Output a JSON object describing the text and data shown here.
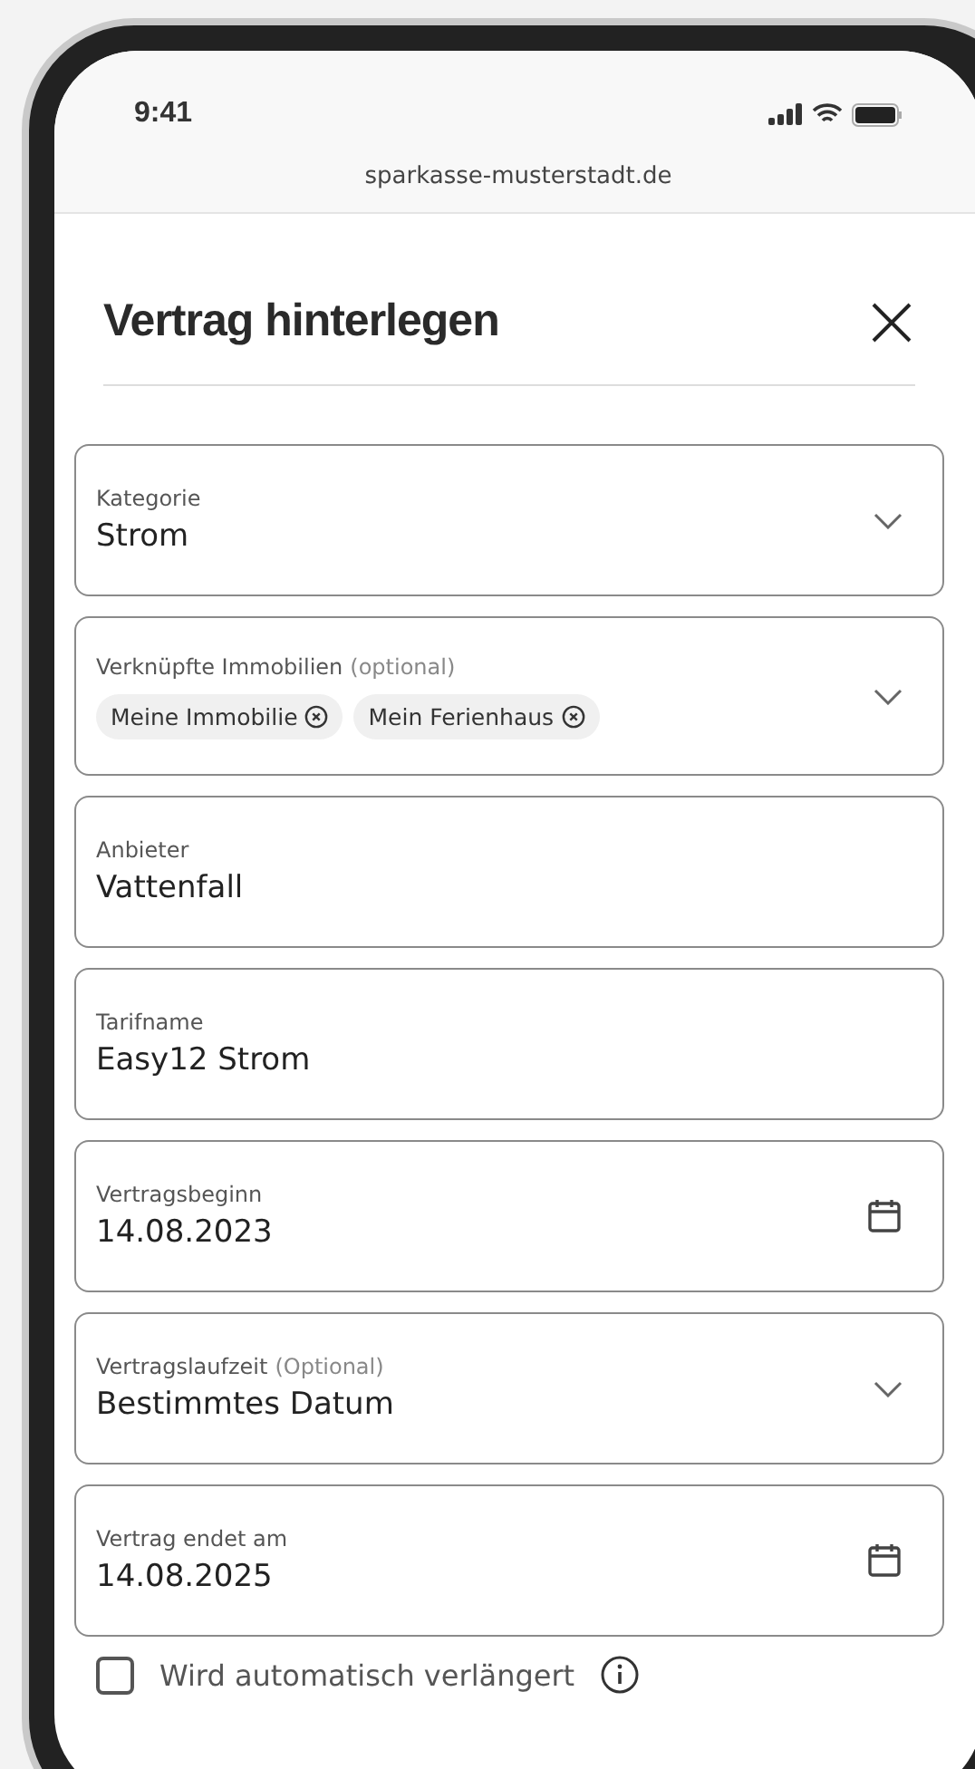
{
  "status_bar": {
    "time": "9:41"
  },
  "browser": {
    "url": "sparkasse-musterstadt.de"
  },
  "dialog": {
    "title": "Vertrag hinterlegen"
  },
  "fields": [
    {
      "kind": "select",
      "label": "Kategorie",
      "value": "Strom"
    },
    {
      "kind": "tags",
      "label": "Verknüpfte Immobilien",
      "label_note": "(optional)",
      "tags": [
        "Meine Immobilie",
        "Mein Ferienhaus"
      ]
    },
    {
      "kind": "text",
      "label": "Anbieter",
      "value": "Vattenfall"
    },
    {
      "kind": "text",
      "label": "Tarifname",
      "value": "Easy12 Strom"
    },
    {
      "kind": "date",
      "label": "Vertragsbeginn",
      "value": "14.08.2023"
    },
    {
      "kind": "select",
      "label": "Vertragslaufzeit",
      "label_note": "(Optional)",
      "value": "Bestimmtes Datum"
    },
    {
      "kind": "date",
      "label": "Vertrag endet am",
      "value": "14.08.2025"
    }
  ],
  "auto_renew": {
    "label": "Wird automatisch verlängert",
    "checked": false
  }
}
